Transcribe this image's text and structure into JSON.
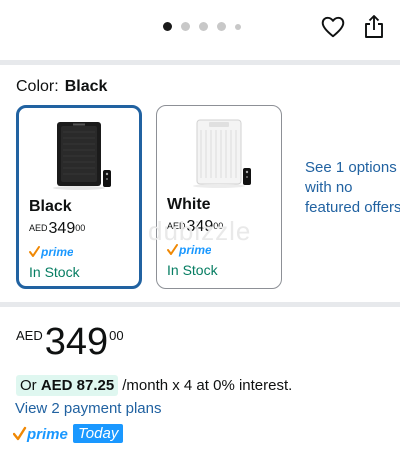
{
  "carousel": {
    "dot_count": 4,
    "active_index": 0
  },
  "color_selector": {
    "label": "Color:",
    "selected": "Black",
    "options": [
      {
        "name": "Black",
        "currency": "AED",
        "price_whole": "349",
        "price_fraction": "00",
        "prime_label": "prime",
        "stock": "In Stock",
        "selected": true
      },
      {
        "name": "White",
        "currency": "AED",
        "price_whole": "349",
        "price_fraction": "00",
        "prime_label": "prime",
        "stock": "In Stock",
        "selected": false
      }
    ],
    "see_options_text": "See 1 options with no featured offers"
  },
  "watermark": "dubizzle",
  "price": {
    "currency": "AED",
    "whole": "349",
    "fraction": "00"
  },
  "installment": {
    "prefix": "Or",
    "amount": "AED 87.25",
    "suffix": "/month x 4 at 0% interest.",
    "plans_link": "View 2 payment plans"
  },
  "prime_delivery": {
    "prime_label": "prime",
    "badge": "Today"
  },
  "colors": {
    "accent_blue": "#2162a1",
    "in_stock_green": "#067d62",
    "prime_blue": "#1a98ff",
    "prime_check_orange": "#f08804"
  }
}
